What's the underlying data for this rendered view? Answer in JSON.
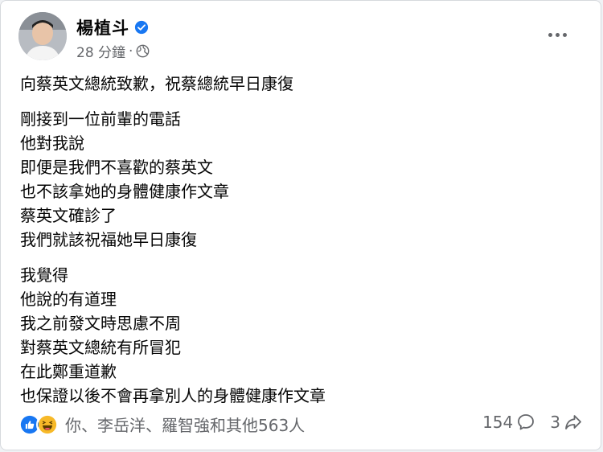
{
  "post": {
    "author": "楊植斗",
    "time": "28 分鐘",
    "separator": "·",
    "privacy_icon": "globe-icon",
    "verified_icon": "verified-badge-icon",
    "more_icon": "more-options-icon"
  },
  "content": {
    "headline": "向蔡英文總統致歉，祝蔡總統早日康復",
    "para1": [
      "剛接到一位前輩的電話",
      "他對我說",
      "即便是我們不喜歡的蔡英文",
      "也不該拿她的身體健康作文章",
      "蔡英文確診了",
      "我們就該祝福她早日康復"
    ],
    "para2": [
      "我覺得",
      "他說的有道理",
      "我之前發文時思慮不周",
      "對蔡英文總統有所冒犯",
      "在此鄭重道歉",
      "也保證以後不會再拿別人的身體健康作文章"
    ]
  },
  "footer": {
    "reaction_icons": [
      "like-icon",
      "haha-icon"
    ],
    "reaction_summary": "你、李岳洋、羅智強和其他563人",
    "comments": "154",
    "shares": "3"
  },
  "colors": {
    "primary_text": "#050505",
    "secondary_text": "#65676b",
    "like_blue": "#1877f2",
    "haha_yellow": "#f7b928"
  }
}
